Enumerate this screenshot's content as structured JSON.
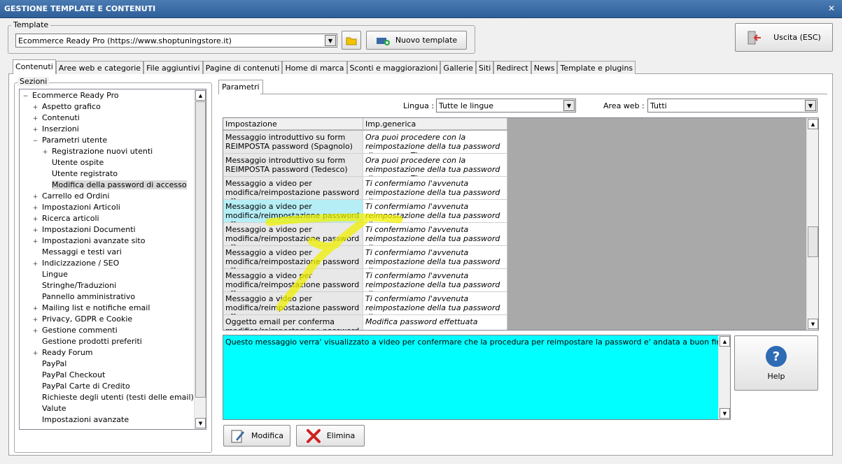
{
  "window": {
    "title": "GESTIONE TEMPLATE E CONTENUTI",
    "close": "✕"
  },
  "template_group": {
    "label": "Template",
    "selected": "Ecommerce Ready Pro (https://www.shoptuningstore.it)",
    "new_template_label": "Nuovo template"
  },
  "exit_button": {
    "label": "Uscita (ESC)"
  },
  "tabs": [
    "Contenuti",
    "Aree web e categorie",
    "File aggiuntivi",
    "Pagine di contenuti",
    "Home di marca",
    "Sconti e maggiorazioni",
    "Gallerie",
    "Siti",
    "Redirect",
    "News",
    "Template e plugins"
  ],
  "sections": {
    "label": "Sezioni",
    "items": [
      {
        "label": "Ecommerce Ready Pro",
        "level": 0,
        "exp": "-"
      },
      {
        "label": "Aspetto grafico",
        "level": 1,
        "exp": "+"
      },
      {
        "label": "Contenuti",
        "level": 1,
        "exp": "+"
      },
      {
        "label": "Inserzioni",
        "level": 1,
        "exp": "+"
      },
      {
        "label": "Parametri utente",
        "level": 1,
        "exp": "-"
      },
      {
        "label": "Registrazione nuovi utenti",
        "level": 2,
        "exp": "+"
      },
      {
        "label": "Utente ospite",
        "level": 2,
        "exp": ""
      },
      {
        "label": "Utente registrato",
        "level": 2,
        "exp": ""
      },
      {
        "label": "Modifica della password di accesso",
        "level": 2,
        "exp": "",
        "selected": true
      },
      {
        "label": "Carrello ed Ordini",
        "level": 1,
        "exp": "+"
      },
      {
        "label": "Impostazioni Articoli",
        "level": 1,
        "exp": "+"
      },
      {
        "label": "Ricerca articoli",
        "level": 1,
        "exp": "+"
      },
      {
        "label": "Impostazioni Documenti",
        "level": 1,
        "exp": "+"
      },
      {
        "label": "Impostazioni avanzate sito",
        "level": 1,
        "exp": "+"
      },
      {
        "label": "Messaggi e testi vari",
        "level": 1,
        "exp": ""
      },
      {
        "label": "Indicizzazione / SEO",
        "level": 1,
        "exp": "+"
      },
      {
        "label": "Lingue",
        "level": 1,
        "exp": ""
      },
      {
        "label": "Stringhe/Traduzioni",
        "level": 1,
        "exp": ""
      },
      {
        "label": "Pannello amministrativo",
        "level": 1,
        "exp": ""
      },
      {
        "label": "Mailing list e notifiche email",
        "level": 1,
        "exp": "+"
      },
      {
        "label": "Privacy, GDPR e Cookie",
        "level": 1,
        "exp": "+"
      },
      {
        "label": "Gestione commenti",
        "level": 1,
        "exp": "+"
      },
      {
        "label": "Gestione prodotti preferiti",
        "level": 1,
        "exp": ""
      },
      {
        "label": "Ready Forum",
        "level": 1,
        "exp": "+"
      },
      {
        "label": "PayPal",
        "level": 1,
        "exp": ""
      },
      {
        "label": "PayPal Checkout",
        "level": 1,
        "exp": ""
      },
      {
        "label": "PayPal Carte di Credito",
        "level": 1,
        "exp": ""
      },
      {
        "label": "Richieste degli utenti (testi delle email)",
        "level": 1,
        "exp": ""
      },
      {
        "label": "Valute",
        "level": 1,
        "exp": ""
      },
      {
        "label": "Impostazioni avanzate",
        "level": 1,
        "exp": ""
      }
    ]
  },
  "params": {
    "tab": "Parametri",
    "lingua_label": "Lingua :",
    "lingua_value": "Tutte le lingue",
    "area_label": "Area web :",
    "area_value": "Tutti",
    "col_impostazione": "Impostazione",
    "col_generica": "Imp.generica",
    "rows": [
      {
        "a": "Messaggio introduttivo su form REIMPOSTA password (Spagnolo)",
        "b": "Ora puoi procedere con la reimpostazione della tua password di accesso. Ti racco..."
      },
      {
        "a": "Messaggio introduttivo su form REIMPOSTA password (Tedesco)",
        "b": "Ora puoi procedere con la reimpostazione della tua password di accesso. Ti racco..."
      },
      {
        "a": "Messaggio a video per modifica/reimpostazione password eff...",
        "b": "Ti confermiamo l'avvenuta reimpostazione della tua password di accesso."
      },
      {
        "a": "Messaggio a video per modifica/reimpostazione password eff...",
        "b": "Ti confermiamo l'avvenuta reimpostazione della tua password di accesso.",
        "selected": true
      },
      {
        "a": "Messaggio a video per modifica/reimpostazione password eff...",
        "b": "Ti confermiamo l'avvenuta reimpostazione della tua password di accesso."
      },
      {
        "a": "Messaggio a video per modifica/reimpostazione password eff...",
        "b": "Ti confermiamo l'avvenuta reimpostazione della tua password di accesso."
      },
      {
        "a": "Messaggio a video per modifica/reimpostazione password eff...",
        "b": "Ti confermiamo l'avvenuta reimpostazione della tua password di accesso."
      },
      {
        "a": "Messaggio a video per modifica/reimpostazione password eff...",
        "b": "Ti confermiamo l'avvenuta reimpostazione della tua password di accesso."
      },
      {
        "a": "Oggetto email per conferma modifica/reimpostazione password (Li...",
        "b": "Modifica password effettuata"
      }
    ],
    "description": "Questo messaggio verra' visualizzato a video per confermare che la procedura per reimpostare la password e' andata a buon fine"
  },
  "buttons": {
    "help": "Help",
    "modifica": "Modifica",
    "elimina": "Elimina"
  },
  "colors": {
    "highlight": "#00ffff",
    "selected_row": "#b6eef5",
    "title": "#3a6aa5",
    "annotation": "#f0f000"
  }
}
